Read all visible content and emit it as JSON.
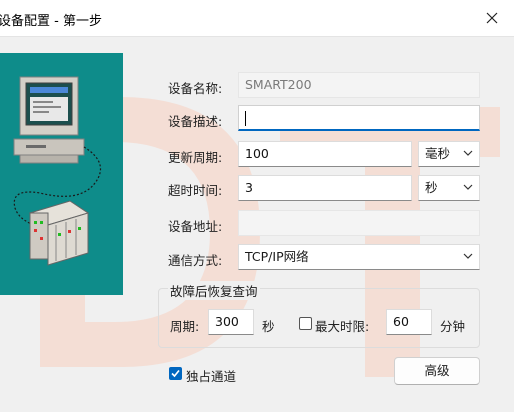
{
  "window": {
    "title": "设备配置 - 第一步"
  },
  "form": {
    "device_name": {
      "label": "设备名称:",
      "value": "SMART200"
    },
    "device_desc": {
      "label": "设备描述:",
      "value": ""
    },
    "update_period": {
      "label": "更新周期:",
      "value": "100",
      "unit": "毫秒"
    },
    "timeout": {
      "label": "超时时间:",
      "value": "3",
      "unit": "秒"
    },
    "device_address": {
      "label": "设备地址:",
      "value": ""
    },
    "comm_mode": {
      "label": "通信方式:",
      "value": "TCP/IP网络"
    }
  },
  "recovery": {
    "title": "故障后恢复查询",
    "period_label": "周期:",
    "period_value": "300",
    "period_unit": "秒",
    "max_time_label": "最大时限:",
    "max_time_checked": false,
    "max_time_value": "60",
    "max_time_unit": "分钟"
  },
  "exclusive_channel": {
    "label": "独占通道",
    "checked": true
  },
  "advanced_button": "高级",
  "colors": {
    "accent": "#0067c0",
    "side_panel": "#0e8c8a",
    "watermark": "#f6d8cc"
  },
  "icons": [
    "close-icon",
    "computer-icon",
    "device-rack-icon",
    "chevron-down-icon",
    "checkmark-icon"
  ]
}
